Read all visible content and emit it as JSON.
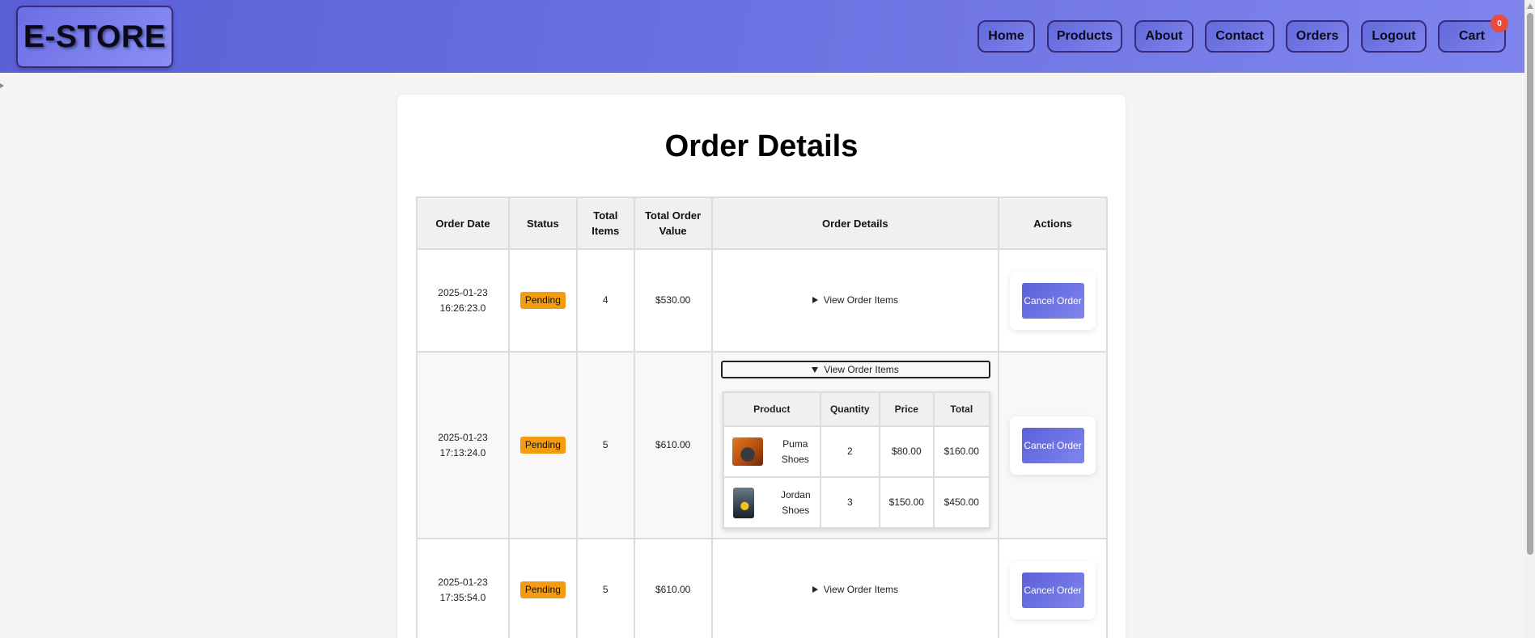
{
  "header": {
    "logo": "E-STORE",
    "nav": [
      "Home",
      "Products",
      "About",
      "Contact",
      "Orders",
      "Logout"
    ],
    "cart_label": "Cart",
    "cart_count": "0"
  },
  "page": {
    "title": "Order Details"
  },
  "orders_table": {
    "headers": {
      "date": "Order Date",
      "status": "Status",
      "total_items": "Total Items",
      "total_value": "Total Order Value",
      "details": "Order Details",
      "actions": "Actions"
    },
    "rows": [
      {
        "date": "2025-01-23 16:26:23.0",
        "status": "Pending",
        "items": "4",
        "value": "$530.00",
        "details_label": "View Order Items",
        "action_label": "Cancel Order"
      },
      {
        "date": "2025-01-23 17:13:24.0",
        "status": "Pending",
        "items": "5",
        "value": "$610.00",
        "details_label": "View Order Items",
        "action_label": "Cancel Order"
      },
      {
        "date": "2025-01-23 17:35:54.0",
        "status": "Pending",
        "items": "5",
        "value": "$610.00",
        "details_label": "View Order Items",
        "action_label": "Cancel Order"
      }
    ]
  },
  "order_items": {
    "headers": {
      "product": "Product",
      "quantity": "Quantity",
      "price": "Price",
      "total": "Total"
    },
    "rows": [
      {
        "product": "Puma Shoes",
        "quantity": "2",
        "price": "$80.00",
        "total": "$160.00"
      },
      {
        "product": "Jordan Shoes",
        "quantity": "3",
        "price": "$150.00",
        "total": "$450.00"
      }
    ]
  },
  "colors": {
    "nav_gradient_start": "#5a5fd6",
    "nav_gradient_end": "#7f84ee",
    "status_pending": "#f39c12",
    "cart_badge": "#e74c3c",
    "button_gradient_start": "#5b60d8"
  }
}
